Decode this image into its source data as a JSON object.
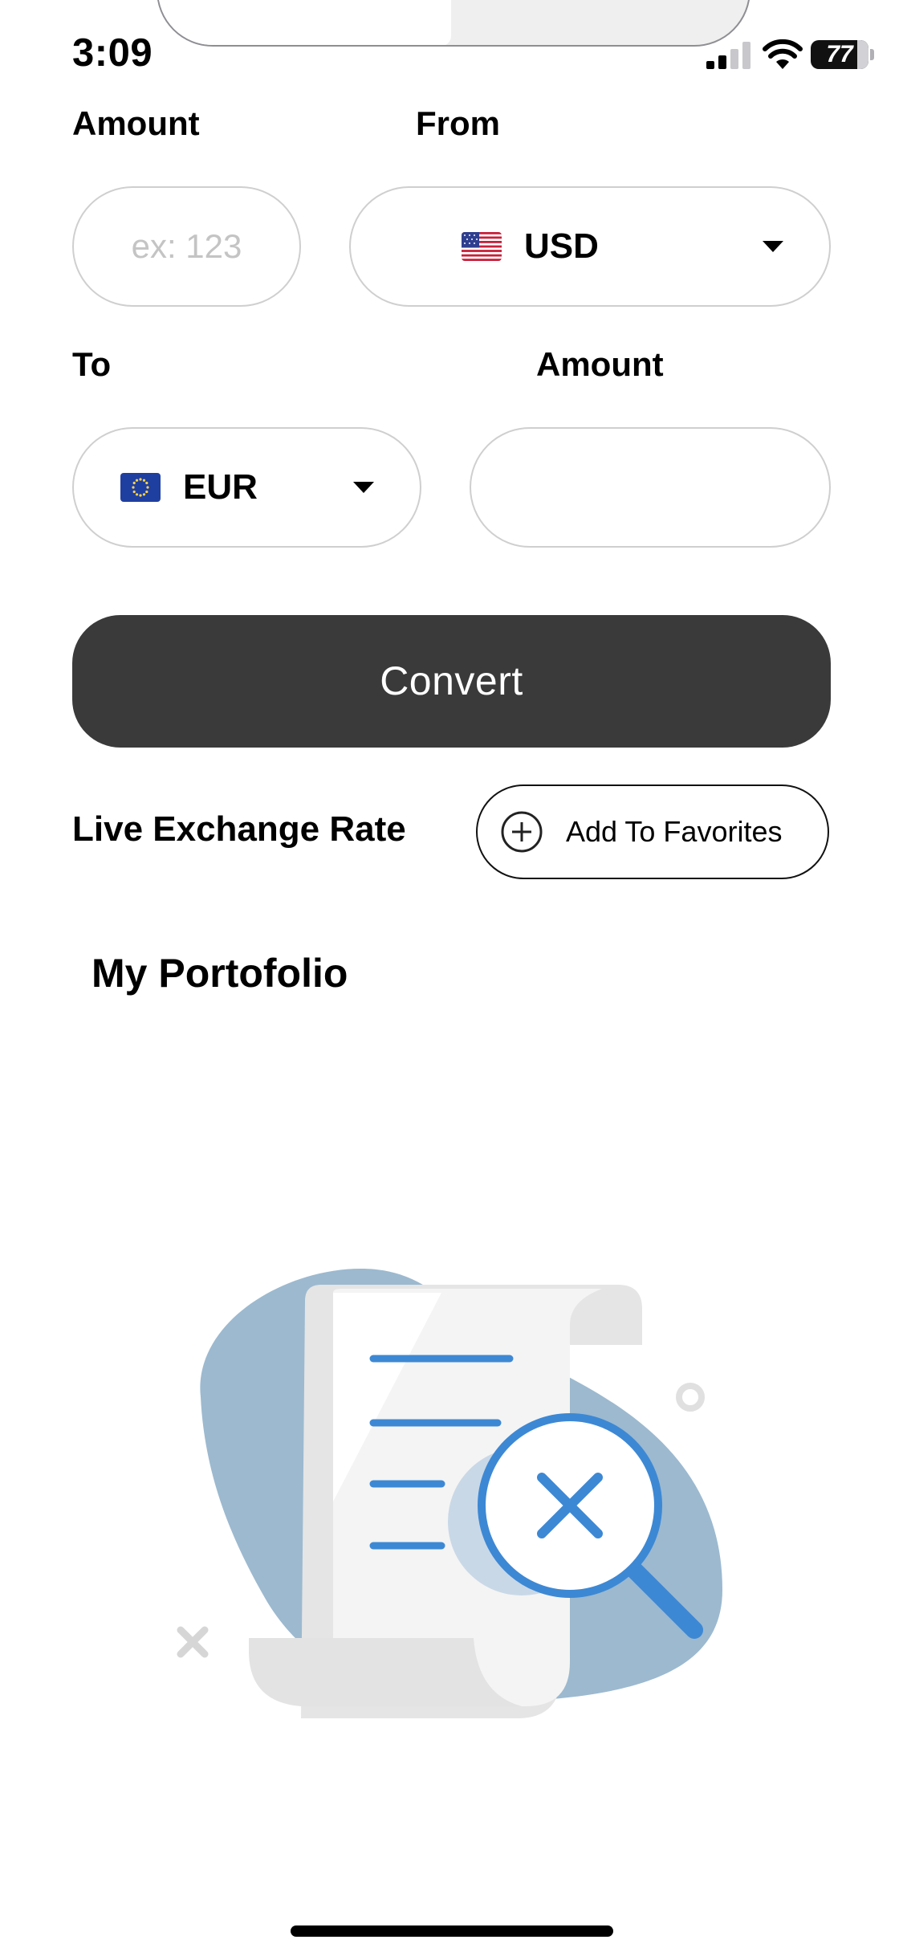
{
  "status_bar": {
    "time": "3:09",
    "battery": "77"
  },
  "form": {
    "amount_label": "Amount",
    "from_label": "From",
    "to_label": "To",
    "result_label": "Amount",
    "amount_value": "",
    "amount_placeholder": "ex: 123",
    "result_value": "",
    "from_currency": {
      "code": "USD",
      "flag_icon": "us-flag-icon"
    },
    "to_currency": {
      "code": "EUR",
      "flag_icon": "eu-flag-icon"
    }
  },
  "convert_label": "Convert",
  "live_rate_title": "Live Exchange Rate",
  "favorites_label": "Add To Favorites",
  "portfolio_title": "My Portofolio",
  "empty_state": {
    "icon": "no-results-illustration"
  },
  "colors": {
    "button_dark": "#3a3a3a",
    "illustration_blue": "#3d88d4",
    "blob_blue": "#9cb9cf",
    "field_border": "#cfcfcf"
  }
}
